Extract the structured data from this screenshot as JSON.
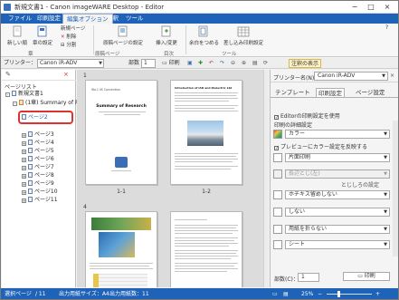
{
  "window": {
    "title": "新規文書1 - Canon imageWARE Desktop - Editor",
    "controls": [
      "−",
      "□",
      "×"
    ]
  },
  "menu_tabs": [
    "ファイル",
    "印刷設定",
    "編集オプション",
    "注釈",
    "ツール"
  ],
  "ribbon": {
    "buttons": {
      "new_page": "新しい順",
      "page_settings": "章の設定",
      "new_page_small": "新規ページ",
      "delete": "削除",
      "split": "分割",
      "page_text": "原稿ページの設定",
      "insert_image": "挿入/変更",
      "merge_to_single": "余白をつめる",
      "print_settings": "差し込み印刷設定"
    },
    "groups": {
      "chapter": "章",
      "edit_page": "原稿ページ",
      "toc": "目次",
      "tools": "ツール"
    }
  },
  "toolbar": {
    "printer_label": "プリンター：",
    "printer_value": "Canon iR-ADV",
    "copies_label": "部数",
    "copies_value": "1",
    "print_label": "印刷",
    "annotation_display": "注釈の表示"
  },
  "left_pane": {
    "title": "ページリスト",
    "tree": {
      "root": "新規文書1",
      "chapter": "(1章) Summary of R...",
      "pages": [
        "ページ2",
        "ページ3",
        "ページ4",
        "ページ5",
        "ページ6",
        "ページ7",
        "ページ8",
        "ページ9",
        "ページ10",
        "ページ11"
      ]
    }
  },
  "center": {
    "spreads": [
      {
        "number": "1",
        "labels": [
          "1-1",
          "1-2"
        ]
      },
      {
        "number": "4",
        "labels": [
          "",
          ""
        ]
      }
    ],
    "page1": {
      "heading": "Summary of Research",
      "subheading": "Wo.1 IIS Convention"
    },
    "page2": {
      "heading": "Introduction of IAR and Dielectric Ltd"
    }
  },
  "right_pane": {
    "printer_label": "プリンター名(N)：",
    "printer_value": "Canon iR-ADV",
    "tabs": [
      "テンプレート",
      "印刷設定",
      "ページ設定"
    ],
    "use_editor_settings": "Editorの印刷設定を使用",
    "print_detail_label": "印刷の詳細設定",
    "color_mode": "カラー",
    "preview_color": "プレビューにカラー設定を反映する",
    "duplex": "片面印刷",
    "binding": "長辺とじ(左)",
    "binding_margin_label": "とじしろの設定",
    "staple": "ホチキス留めしない",
    "punch": "しない",
    "fold": "用紙を折らない",
    "sheet": "シート",
    "copies_label": "部数(C)：",
    "copies_value": "1",
    "print_button": "印刷"
  },
  "status_bar": {
    "selected_page": "選択ページ",
    "selected_page_value": "/ 11",
    "output_size": "出力用紙サイズ：A4",
    "output_count": "出力用紙数：11",
    "zoom": "25%"
  },
  "colors": {
    "accent": "#1f63b8",
    "highlight": "#e03030"
  }
}
